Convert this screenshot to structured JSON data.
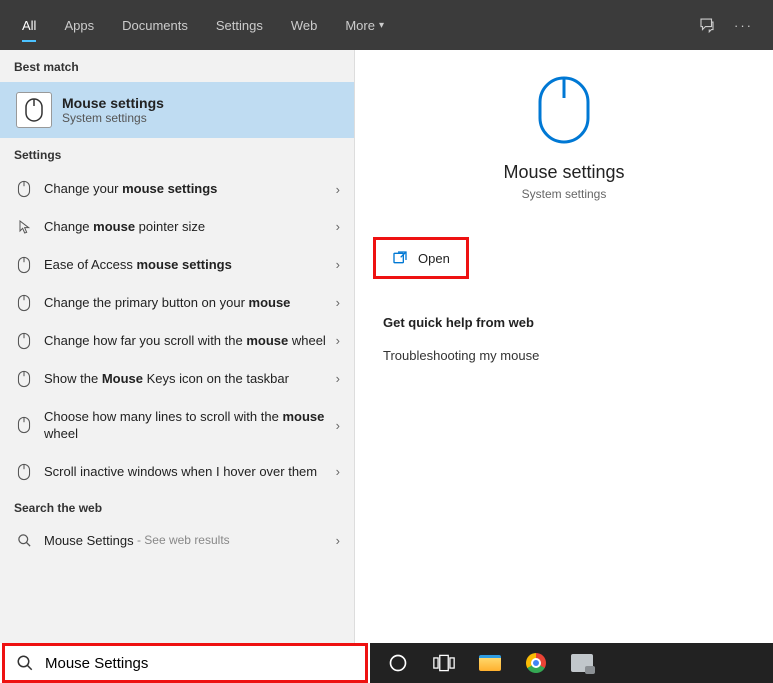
{
  "tabs": {
    "all": "All",
    "apps": "Apps",
    "documents": "Documents",
    "settings": "Settings",
    "web": "Web",
    "more": "More"
  },
  "sections": {
    "best_match": "Best match",
    "settings": "Settings",
    "search_web": "Search the web"
  },
  "best_match": {
    "title": "Mouse settings",
    "subtitle": "System settings"
  },
  "settings_results": [
    {
      "pre": "Change your ",
      "bold": "mouse settings",
      "post": "",
      "icon": "mouse"
    },
    {
      "pre": "Change ",
      "bold": "mouse",
      "post": " pointer size",
      "icon": "pointer"
    },
    {
      "pre": "Ease of Access ",
      "bold": "mouse settings",
      "post": "",
      "icon": "mouse"
    },
    {
      "pre": "Change the primary button on your ",
      "bold": "mouse",
      "post": "",
      "icon": "mouse"
    },
    {
      "pre": "Change how far you scroll with the ",
      "bold": "mouse",
      "post": " wheel",
      "icon": "mouse"
    },
    {
      "pre": "Show the ",
      "bold": "Mouse",
      "post": " Keys icon on the taskbar",
      "icon": "mouse"
    },
    {
      "pre": "Choose how many lines to scroll with the ",
      "bold": "mouse",
      "post": " wheel",
      "icon": "mouse"
    },
    {
      "pre": "Scroll inactive windows when I hover over them",
      "bold": "",
      "post": "",
      "icon": "mouse"
    }
  ],
  "web_result": {
    "title": "Mouse Settings",
    "sub": "See web results"
  },
  "detail": {
    "title": "Mouse settings",
    "subtitle": "System settings",
    "open": "Open",
    "help_header": "Get quick help from web",
    "help_items": [
      "Troubleshooting my mouse"
    ]
  },
  "search": {
    "value": "Mouse Settings"
  }
}
